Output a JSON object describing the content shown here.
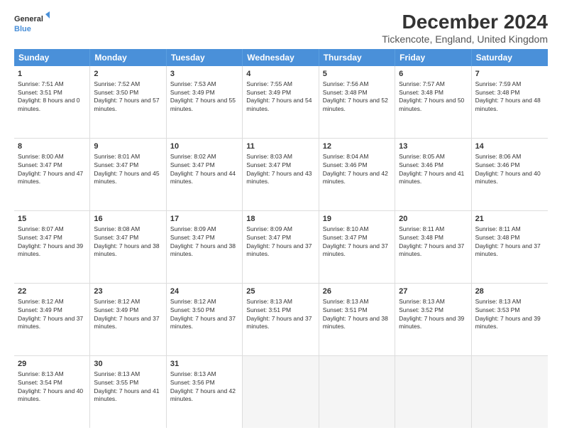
{
  "logo": {
    "line1": "General",
    "line2": "Blue"
  },
  "title": "December 2024",
  "subtitle": "Tickencote, England, United Kingdom",
  "days": [
    "Sunday",
    "Monday",
    "Tuesday",
    "Wednesday",
    "Thursday",
    "Friday",
    "Saturday"
  ],
  "weeks": [
    [
      {
        "day": "1",
        "sunrise": "7:51 AM",
        "sunset": "3:51 PM",
        "daylight": "8 hours and 0 minutes."
      },
      {
        "day": "2",
        "sunrise": "7:52 AM",
        "sunset": "3:50 PM",
        "daylight": "7 hours and 57 minutes."
      },
      {
        "day": "3",
        "sunrise": "7:53 AM",
        "sunset": "3:49 PM",
        "daylight": "7 hours and 55 minutes."
      },
      {
        "day": "4",
        "sunrise": "7:55 AM",
        "sunset": "3:49 PM",
        "daylight": "7 hours and 54 minutes."
      },
      {
        "day": "5",
        "sunrise": "7:56 AM",
        "sunset": "3:48 PM",
        "daylight": "7 hours and 52 minutes."
      },
      {
        "day": "6",
        "sunrise": "7:57 AM",
        "sunset": "3:48 PM",
        "daylight": "7 hours and 50 minutes."
      },
      {
        "day": "7",
        "sunrise": "7:59 AM",
        "sunset": "3:48 PM",
        "daylight": "7 hours and 48 minutes."
      }
    ],
    [
      {
        "day": "8",
        "sunrise": "8:00 AM",
        "sunset": "3:47 PM",
        "daylight": "7 hours and 47 minutes."
      },
      {
        "day": "9",
        "sunrise": "8:01 AM",
        "sunset": "3:47 PM",
        "daylight": "7 hours and 45 minutes."
      },
      {
        "day": "10",
        "sunrise": "8:02 AM",
        "sunset": "3:47 PM",
        "daylight": "7 hours and 44 minutes."
      },
      {
        "day": "11",
        "sunrise": "8:03 AM",
        "sunset": "3:47 PM",
        "daylight": "7 hours and 43 minutes."
      },
      {
        "day": "12",
        "sunrise": "8:04 AM",
        "sunset": "3:46 PM",
        "daylight": "7 hours and 42 minutes."
      },
      {
        "day": "13",
        "sunrise": "8:05 AM",
        "sunset": "3:46 PM",
        "daylight": "7 hours and 41 minutes."
      },
      {
        "day": "14",
        "sunrise": "8:06 AM",
        "sunset": "3:46 PM",
        "daylight": "7 hours and 40 minutes."
      }
    ],
    [
      {
        "day": "15",
        "sunrise": "8:07 AM",
        "sunset": "3:47 PM",
        "daylight": "7 hours and 39 minutes."
      },
      {
        "day": "16",
        "sunrise": "8:08 AM",
        "sunset": "3:47 PM",
        "daylight": "7 hours and 38 minutes."
      },
      {
        "day": "17",
        "sunrise": "8:09 AM",
        "sunset": "3:47 PM",
        "daylight": "7 hours and 38 minutes."
      },
      {
        "day": "18",
        "sunrise": "8:09 AM",
        "sunset": "3:47 PM",
        "daylight": "7 hours and 37 minutes."
      },
      {
        "day": "19",
        "sunrise": "8:10 AM",
        "sunset": "3:47 PM",
        "daylight": "7 hours and 37 minutes."
      },
      {
        "day": "20",
        "sunrise": "8:11 AM",
        "sunset": "3:48 PM",
        "daylight": "7 hours and 37 minutes."
      },
      {
        "day": "21",
        "sunrise": "8:11 AM",
        "sunset": "3:48 PM",
        "daylight": "7 hours and 37 minutes."
      }
    ],
    [
      {
        "day": "22",
        "sunrise": "8:12 AM",
        "sunset": "3:49 PM",
        "daylight": "7 hours and 37 minutes."
      },
      {
        "day": "23",
        "sunrise": "8:12 AM",
        "sunset": "3:49 PM",
        "daylight": "7 hours and 37 minutes."
      },
      {
        "day": "24",
        "sunrise": "8:12 AM",
        "sunset": "3:50 PM",
        "daylight": "7 hours and 37 minutes."
      },
      {
        "day": "25",
        "sunrise": "8:13 AM",
        "sunset": "3:51 PM",
        "daylight": "7 hours and 37 minutes."
      },
      {
        "day": "26",
        "sunrise": "8:13 AM",
        "sunset": "3:51 PM",
        "daylight": "7 hours and 38 minutes."
      },
      {
        "day": "27",
        "sunrise": "8:13 AM",
        "sunset": "3:52 PM",
        "daylight": "7 hours and 39 minutes."
      },
      {
        "day": "28",
        "sunrise": "8:13 AM",
        "sunset": "3:53 PM",
        "daylight": "7 hours and 39 minutes."
      }
    ],
    [
      {
        "day": "29",
        "sunrise": "8:13 AM",
        "sunset": "3:54 PM",
        "daylight": "7 hours and 40 minutes."
      },
      {
        "day": "30",
        "sunrise": "8:13 AM",
        "sunset": "3:55 PM",
        "daylight": "7 hours and 41 minutes."
      },
      {
        "day": "31",
        "sunrise": "8:13 AM",
        "sunset": "3:56 PM",
        "daylight": "7 hours and 42 minutes."
      },
      null,
      null,
      null,
      null
    ]
  ]
}
